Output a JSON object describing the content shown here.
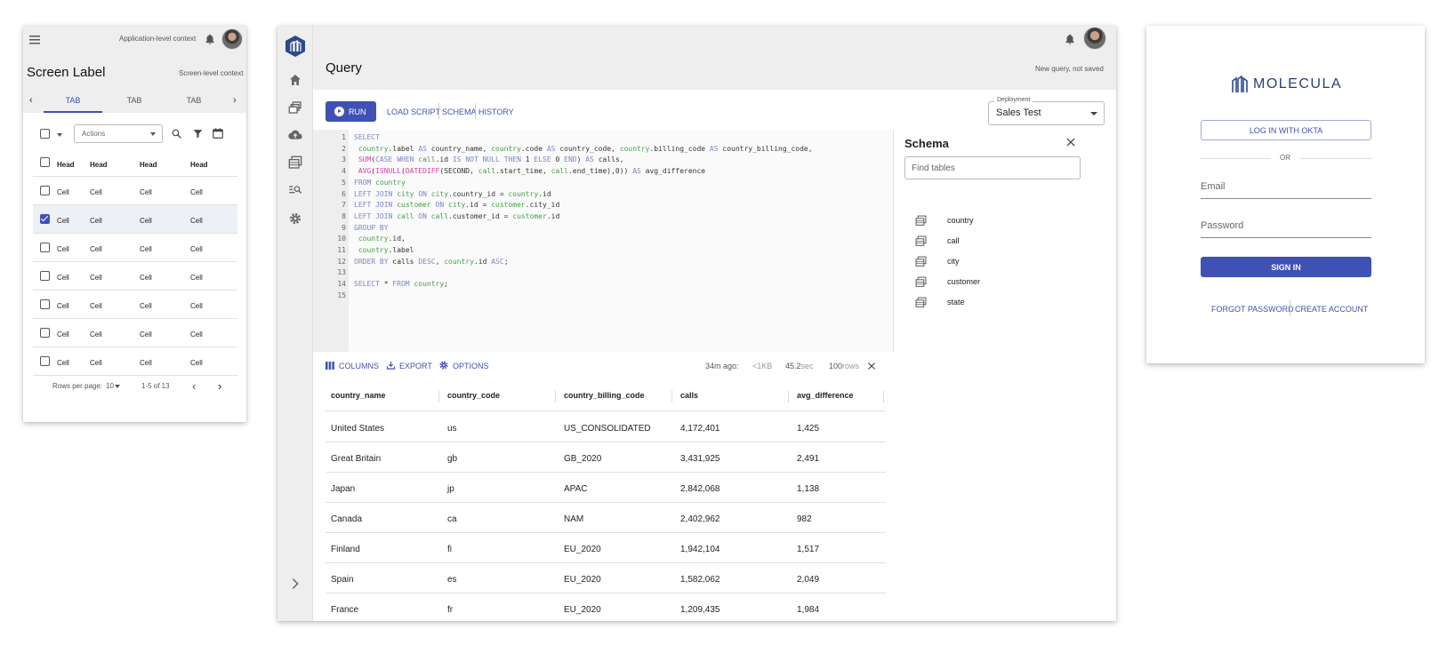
{
  "mobile": {
    "app_context": "Application-level context",
    "screen_label": "Screen Label",
    "screen_context": "Screen-level context",
    "tabs": [
      "TAB",
      "TAB",
      "TAB"
    ],
    "actions_placeholder": "Actions",
    "head_labels": [
      "Head",
      "Head",
      "Head",
      "Head"
    ],
    "rows": [
      {
        "checked": false,
        "cells": [
          "Cell",
          "Cell",
          "Cell",
          "Cell"
        ]
      },
      {
        "checked": true,
        "cells": [
          "Cell",
          "Cell",
          "Cell",
          "Cell"
        ]
      },
      {
        "checked": false,
        "cells": [
          "Cell",
          "Cell",
          "Cell",
          "Cell"
        ]
      },
      {
        "checked": false,
        "cells": [
          "Cell",
          "Cell",
          "Cell",
          "Cell"
        ]
      },
      {
        "checked": false,
        "cells": [
          "Cell",
          "Cell",
          "Cell",
          "Cell"
        ]
      },
      {
        "checked": false,
        "cells": [
          "Cell",
          "Cell",
          "Cell",
          "Cell"
        ]
      },
      {
        "checked": false,
        "cells": [
          "Cell",
          "Cell",
          "Cell",
          "Cell"
        ]
      }
    ],
    "rows_per_page_label": "Rows per page:",
    "rows_per_page_value": "10",
    "range_text": "1-5 of 13"
  },
  "query": {
    "title": "Query",
    "status": "New query, not saved",
    "run_label": "RUN",
    "toolbar_links": [
      "LOAD SCRIPT",
      "SCHEMA",
      "HISTORY"
    ],
    "deployment_label": "Deployment",
    "deployment_value": "Sales Test",
    "code_lines": [
      "SELECT",
      " country.label AS country_name, country.code AS country_code, country.billing_code AS country_billing_code,",
      " SUM(CASE WHEN call.id IS NOT NULL THEN 1 ELSE 0 END) AS calls,",
      " AVG(ISNULL(DATEDIFF(SECOND, call.start_time, call.end_time),0)) AS avg_difference",
      "FROM country",
      "LEFT JOIN city ON city.country_id = country.id",
      "LEFT JOIN customer ON city.id = customer.city_id",
      "LEFT JOIN call ON call.customer_id = customer.id",
      "GROUP BY",
      " country.id,",
      " country.label",
      "ORDER BY calls DESC, country.id ASC;",
      "",
      "SELECT * FROM country;",
      ""
    ],
    "line_numbers": [
      "1",
      "2",
      "3",
      "4",
      "5",
      "6",
      "7",
      "8",
      "9",
      "10",
      "11",
      "12",
      "13",
      "14",
      "15"
    ],
    "schema": {
      "title": "Schema",
      "search_placeholder": "Find tables",
      "tables": [
        "country",
        "call",
        "city",
        "customer",
        "state"
      ]
    },
    "results_toolbar": {
      "columns_label": "COLUMNS",
      "export_label": "EXPORT",
      "options_label": "OPTIONS",
      "ago": "34m ago:",
      "size": "<1KB",
      "time_value": "45.2",
      "time_unit": "sec",
      "rows_value": "100",
      "rows_unit": "rows"
    },
    "columns": [
      "country_name",
      "country_code",
      "country_billing_code",
      "calls",
      "avg_difference"
    ],
    "rows": [
      [
        "United States",
        "us",
        "US_CONSOLIDATED",
        "4,172,401",
        "1,425"
      ],
      [
        "Great Britain",
        "gb",
        "GB_2020",
        "3,431,925",
        "2,491"
      ],
      [
        "Japan",
        "jp",
        "APAC",
        "2,842,068",
        "1,138"
      ],
      [
        "Canada",
        "ca",
        "NAM",
        "2,402,962",
        "982"
      ],
      [
        "Finland",
        "fi",
        "EU_2020",
        "1,942,104",
        "1,517"
      ],
      [
        "Spain",
        "es",
        "EU_2020",
        "1,582,062",
        "2,049"
      ],
      [
        "France",
        "fr",
        "EU_2020",
        "1,209,435",
        "1,984"
      ]
    ]
  },
  "login": {
    "brand": "MOLECULA",
    "okta_label": "LOG IN WITH OKTA",
    "or_label": "OR",
    "email_placeholder": "Email",
    "password_placeholder": "Password",
    "signin_label": "SIGN IN",
    "forgot_label": "FORGOT PASSWORD",
    "create_label": "CREATE ACCOUNT"
  },
  "colors": {
    "accent": "#3f51b5",
    "keyword": "#7986cb",
    "function": "#e040a0",
    "table": "#43a047"
  }
}
